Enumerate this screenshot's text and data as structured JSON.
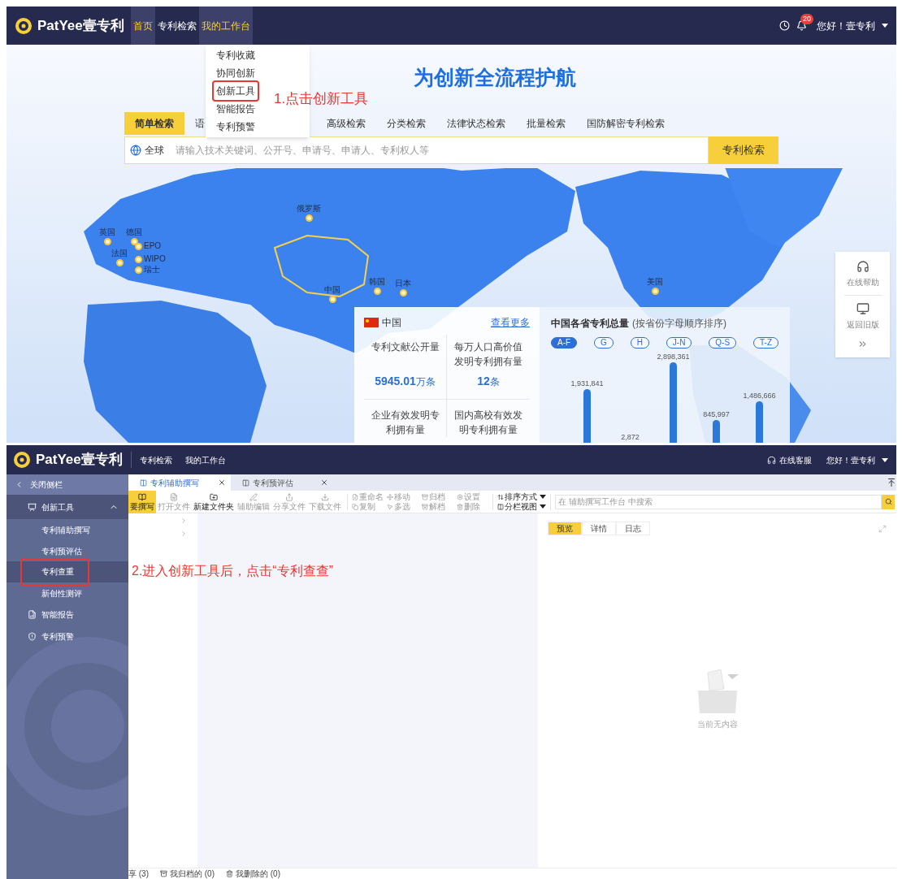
{
  "top_screen": {
    "header": {
      "logo": "PatYee壹专利",
      "nav": [
        {
          "label": "首页",
          "selected": true
        },
        {
          "label": "专利检索",
          "selected": false
        },
        {
          "label": "我的工作台",
          "selected": true
        }
      ],
      "notification_count": "20",
      "greeting": "您好！壹专利"
    },
    "dropdown": [
      {
        "label": "专利收藏",
        "annotated": false
      },
      {
        "label": "协同创新",
        "annotated": false
      },
      {
        "label": "创新工具",
        "annotated": true
      },
      {
        "label": "智能报告",
        "annotated": false
      },
      {
        "label": "专利预警",
        "annotated": false
      }
    ],
    "annotation": "1.点击创新工具",
    "headline": "为创新全流程护航",
    "search_tabs": [
      {
        "label": "简单检索",
        "selected": true
      },
      {
        "label": "语",
        "selected": false
      },
      {
        "label": "高级检索",
        "selected": false
      },
      {
        "label": "分类检索",
        "selected": false
      },
      {
        "label": "法律状态检索",
        "selected": false
      },
      {
        "label": "批量检索",
        "selected": false
      },
      {
        "label": "国防解密专利检索",
        "selected": false
      }
    ],
    "search": {
      "scope": "全球",
      "placeholder": "请输入技术关键词、公开号、申请号、申请人、专利权人等",
      "button": "专利检索"
    },
    "map_pins": [
      "俄罗斯",
      "英国",
      "德国",
      "法国",
      "EPO",
      "WIPO",
      "瑞士",
      "中国",
      "韩国",
      "日本",
      "美国"
    ],
    "country_panel": {
      "country": "中国",
      "more_link": "查看更多",
      "stats": [
        {
          "label": "专利文献公开量",
          "value": "5945.01",
          "unit": "万条"
        },
        {
          "label": "每万人口高价值发明专利拥有量",
          "value": "12",
          "unit": "条"
        },
        {
          "label": "企业有效发明专利拥有量"
        },
        {
          "label": "国内高校有效发明专利拥有量"
        }
      ]
    },
    "province_panel": {
      "title": "中国各省专利总量",
      "subtitle": "(按省份字母顺序排序)",
      "filters": [
        {
          "label": "A-F",
          "selected": true
        },
        {
          "label": "G",
          "selected": false
        },
        {
          "label": "H",
          "selected": false
        },
        {
          "label": "J-N",
          "selected": false
        },
        {
          "label": "Q-S",
          "selected": false
        },
        {
          "label": "T-Z",
          "selected": false
        }
      ],
      "bar_labels": [
        "1,931,841",
        "2,872",
        "2,898,361",
        "845,997",
        "1,486,666"
      ]
    },
    "side_panel": [
      {
        "label": "在线帮助",
        "kind": "help"
      },
      {
        "label": "返回旧版",
        "kind": "legacy"
      }
    ]
  },
  "bottom_screen": {
    "header": {
      "logo": "PatYee壹专利",
      "nav": [
        "专利检索",
        "我的工作台"
      ],
      "service": "在线客服",
      "greeting": "您好！壹专利"
    },
    "sidebar": {
      "close": "关闭侧栏",
      "group": {
        "label": "创新工具",
        "expanded": true,
        "children": [
          {
            "label": "专利辅助撰写",
            "selected": false,
            "annotated": false
          },
          {
            "label": "专利预评估",
            "selected": false,
            "annotated": false
          },
          {
            "label": "专利查重",
            "selected": true,
            "annotated": true
          },
          {
            "label": "新创性测评",
            "selected": false,
            "annotated": false
          }
        ]
      },
      "items": [
        {
          "label": "智能报告",
          "kind": "report"
        },
        {
          "label": "专利预警",
          "kind": "alert"
        }
      ]
    },
    "annotation": "2.进入创新工具后，点击“专利查查”",
    "tabs": [
      {
        "label": "专利辅助撰写",
        "selected": true
      },
      {
        "label": "专利预评估",
        "selected": false
      }
    ],
    "toolbar": {
      "main": [
        {
          "label": "要撰写",
          "kind": "write",
          "selected": true,
          "disabled": false
        },
        {
          "label": "打开文件",
          "kind": "open",
          "selected": false,
          "disabled": true
        },
        {
          "label": "新建文件夹",
          "kind": "folder",
          "selected": false,
          "disabled": false
        },
        {
          "label": "辅助编辑",
          "kind": "edit",
          "selected": false,
          "disabled": true
        },
        {
          "label": "分享文件",
          "kind": "share",
          "selected": false,
          "disabled": true
        },
        {
          "label": "下载文件",
          "kind": "download",
          "selected": false,
          "disabled": true
        }
      ],
      "small": [
        {
          "label": "重命名",
          "kind": "rename",
          "disabled": true
        },
        {
          "label": "移动",
          "kind": "move",
          "disabled": true
        },
        {
          "label": "归档",
          "kind": "archive",
          "disabled": true
        },
        {
          "label": "设置",
          "kind": "settings",
          "disabled": true
        },
        {
          "label": "复制",
          "kind": "copy",
          "disabled": true
        },
        {
          "label": "多选",
          "kind": "select",
          "disabled": true
        },
        {
          "label": "解档",
          "kind": "unarchive",
          "disabled": true
        },
        {
          "label": "删除",
          "kind": "delete",
          "disabled": true
        }
      ],
      "view": [
        {
          "label": "排序方式",
          "kind": "sort"
        },
        {
          "label": "分栏视图",
          "kind": "columns"
        }
      ],
      "search_placeholder": "在 辅助撰写工作台 中搜索"
    },
    "preview_tabs": [
      {
        "label": "预览",
        "selected": true
      },
      {
        "label": "详情",
        "selected": false
      },
      {
        "label": "日志",
        "selected": false
      }
    ],
    "empty_text": "当前无内容",
    "status": [
      {
        "label": "享 (3)",
        "kind": "share"
      },
      {
        "label": "我归档的 (0)",
        "kind": "archive"
      },
      {
        "label": "我删除的 (0)",
        "kind": "trash"
      }
    ]
  }
}
